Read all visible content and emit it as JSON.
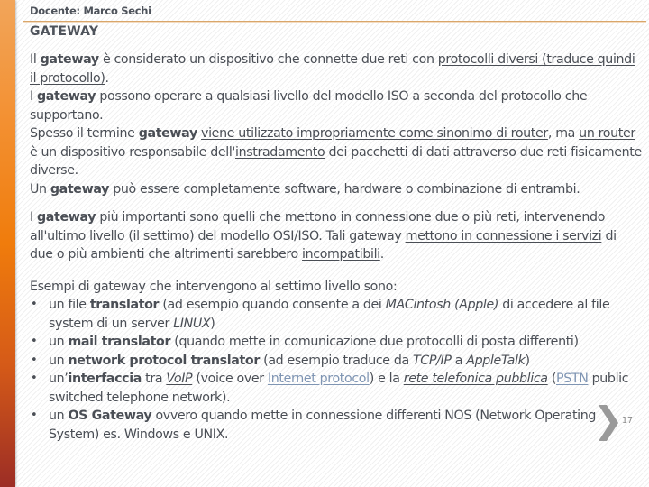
{
  "header": {
    "teacher": "Docente: Marco Sechi"
  },
  "slide": {
    "title": "GATEWAY",
    "page_number": "17"
  },
  "colors": {
    "accent_bar_top": "#f2a55a",
    "accent_bar_mid": "#f07c0c",
    "accent_bar_bottom": "#9c2d25",
    "header_rule": "#d9a66a",
    "text": "#4a4e55",
    "link": "#7f95b3"
  },
  "p1": {
    "s1": "Il ",
    "b1": "gateway",
    "s2": " è considerato un dispositivo che connette due reti con ",
    "u1": "protocolli diversi (traduce quindi il protocollo)",
    "s3": ".",
    "s4": "I ",
    "b2": "gateway",
    "s5": " possono operare a qualsiasi livello del modello ISO a seconda del protocollo che supportano.",
    "s6": "Spesso il termine ",
    "b3": "gateway",
    "s7": " ",
    "u2": "viene utilizzato impropriamente come sinonimo di router",
    "s8": ", ma ",
    "u3": "un router",
    "s9": " è un dispositivo responsabile dell'",
    "u4": "instradamento",
    "s10": " dei pacchetti di dati attraverso due reti fisicamente diverse.",
    "s11": "Un ",
    "b4": "gateway",
    "s12": " può essere completamente software, hardware o combinazione di entrambi."
  },
  "p2": {
    "s1": "I ",
    "b1": "gateway",
    "s2": " più importanti sono quelli che mettono in connessione due o più reti, intervenendo all'ultimo livello (il settimo) del modello OSI/ISO. Tali gateway ",
    "u1": "mettono in connessione i servizi",
    "s3": " di due o più ambienti che altrimenti sarebbero ",
    "u2": "incompatibili",
    "s4": "."
  },
  "p3": {
    "intro": "Esempi di gateway che intervengono al settimo livello sono:",
    "bullet_glyph": "•",
    "items": [
      {
        "s1": "un file ",
        "b1": "translator",
        "s2": " (ad esempio quando consente a dei ",
        "i1": "MACintosh (Apple)",
        "s3": " di accedere al file system di un server ",
        "i2": "LINUX",
        "s4": ")"
      },
      {
        "s1": "un ",
        "b1": "mail translator",
        "s2": " (quando mette in comunicazione due protocolli di posta differenti)"
      },
      {
        "s1": "un ",
        "b1": "network protocol translator",
        "s2": " (ad esempio traduce da ",
        "i1": "TCP/IP",
        "s3": " a ",
        "i2": "AppleTalk",
        "s4": ")"
      },
      {
        "s1": "un’",
        "b1": "interfaccia",
        "s2": " tra ",
        "ui1": "VoIP",
        "s3": " (voice over ",
        "link1": "Internet protocol",
        "s4": ") e la ",
        "ui2": "rete telefonica pubblica",
        "s5": " (",
        "link2": "PSTN",
        "s6": " public switched telephone network)."
      },
      {
        "s1": "un ",
        "b1": "OS Gateway",
        "s2": " ovvero quando mette in connessione differenti NOS (Network Operating System) es. Windows e UNIX."
      }
    ]
  }
}
